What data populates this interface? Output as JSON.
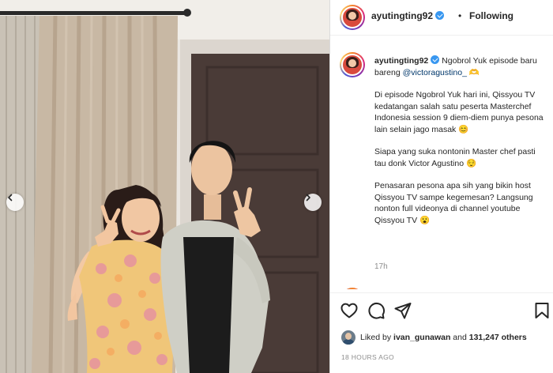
{
  "header": {
    "username": "ayutingting92",
    "dot": "•",
    "follow_label": "Following"
  },
  "caption": {
    "username": "ayutingting92",
    "line1_text": " Ngobrol Yuk episode baru bareng ",
    "mention": "@victoragustino_",
    "line1_tail": " 🫶",
    "para2": "Di episode Ngobrol Yuk hari ini, Qissyou TV kedatangan salah satu peserta Masterchef Indonesia session 9 diem-diem punya pesona lain selain jago masak 😊",
    "para3": "Siapa yang suka nontonin Master chef pasti tau donk Victor Agustino 😌",
    "para4": "Penasaran pesona apa sih yang bikin host Qissyou TV sampe kegemesan? Langsung nonton full videonya di channel youtube Qissyou TV 😮",
    "time": "17h"
  },
  "likes": {
    "prefix": "Liked by ",
    "liker": "ivan_gunawan",
    "middle": " and ",
    "count": "131,247 others"
  },
  "post_time": "18 HOURS AGO",
  "icons": {
    "verified": "verified-badge-icon",
    "like": "heart-icon",
    "comment": "comment-bubble-icon",
    "share": "paper-plane-icon",
    "save": "bookmark-icon",
    "prev": "chevron-left-icon",
    "next": "chevron-right-icon"
  },
  "colors": {
    "verified_blue": "#3897f0",
    "mention_blue": "#00376b",
    "muted_gray": "#8e8e8e"
  }
}
